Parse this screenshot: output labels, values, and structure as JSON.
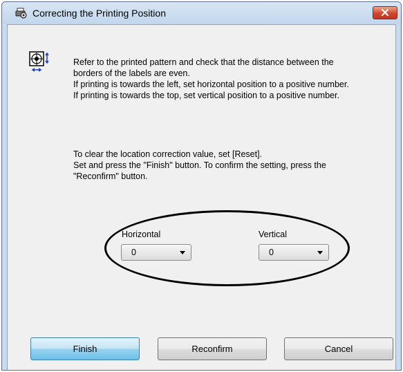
{
  "window": {
    "title": "Correcting the Printing Position",
    "icons": {
      "title": "printer-gear-icon",
      "close": "close-icon",
      "info": "crosshair-position-icon"
    }
  },
  "instructions": {
    "lines": [
      "Refer to the printed pattern and check that the distance between the",
      "borders of the labels are even.",
      "If printing is towards the left, set horizontal position to a positive number.",
      "If printing is towards the top, set vertical position to a positive number."
    ]
  },
  "notes": {
    "lines": [
      "To clear the location correction value, set [Reset].",
      "Set and press the \"Finish\" button. To confirm the setting, press the",
      "\"Reconfirm\" button."
    ]
  },
  "position": {
    "horizontal": {
      "label": "Horizontal",
      "value": "0"
    },
    "vertical": {
      "label": "Vertical",
      "value": "0"
    }
  },
  "buttons": {
    "finish": "Finish",
    "reconfirm": "Reconfirm",
    "cancel": "Cancel"
  },
  "colors": {
    "title_bar": "#c9dcef",
    "client": "#f0f0f0",
    "close_button": "#d1462c",
    "default_button": "#98d1ef"
  }
}
